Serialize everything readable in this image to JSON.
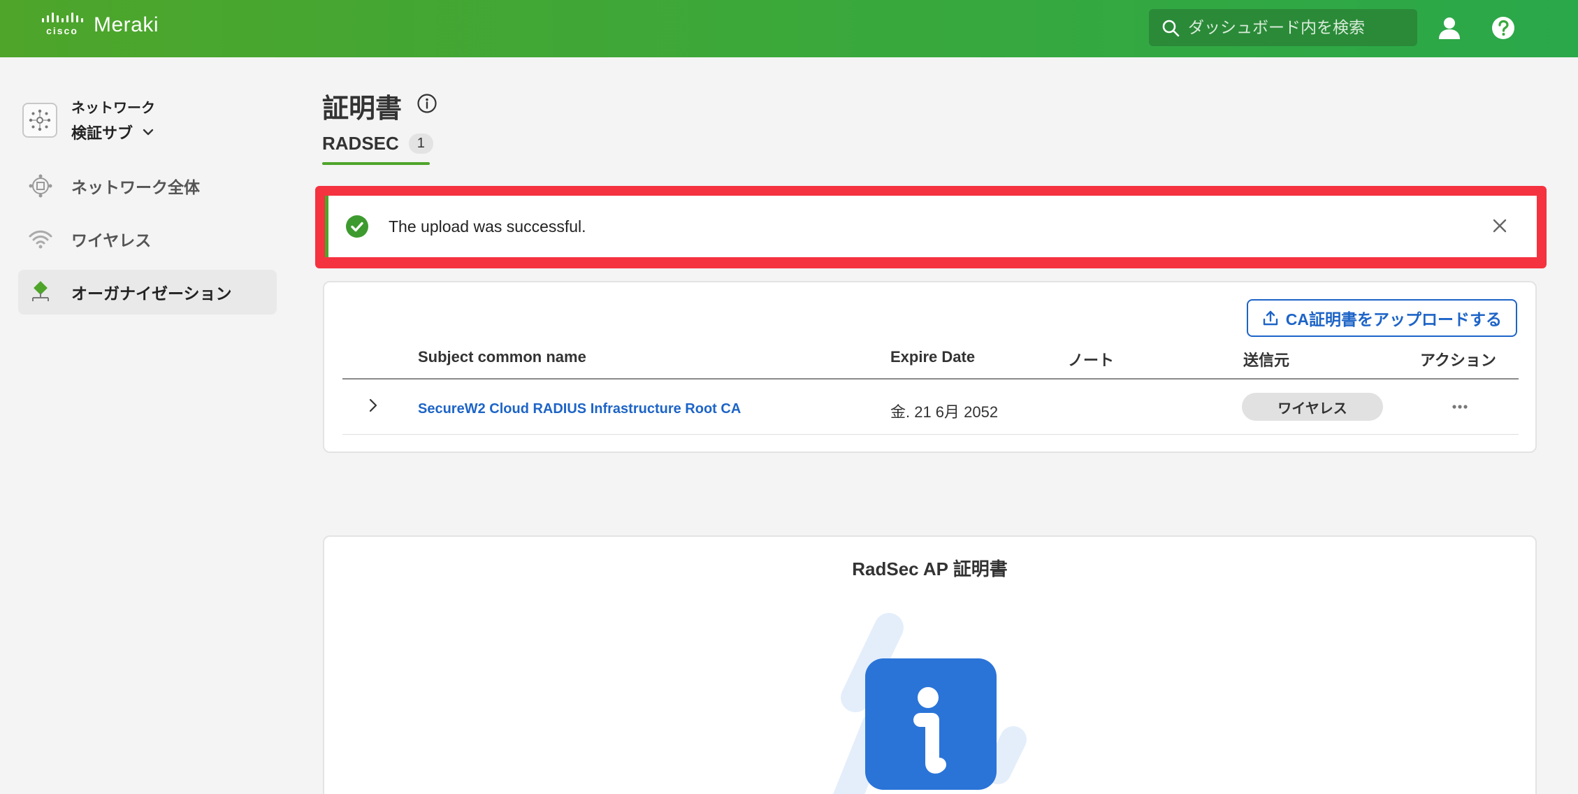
{
  "header": {
    "brand_sub": "cisco",
    "brand_name": "Meraki",
    "search_placeholder": "ダッシュボード内を検索"
  },
  "sidebar": {
    "network_label": "ネットワーク",
    "network_name": "検証サブ",
    "items": [
      {
        "label": "ネットワーク全体"
      },
      {
        "label": "ワイヤレス"
      },
      {
        "label": "オーガナイゼーション"
      }
    ]
  },
  "page": {
    "title": "証明書",
    "tab_label": "RADSEC",
    "tab_count": "1"
  },
  "alert": {
    "message": "The upload was successful."
  },
  "certificates": {
    "upload_label": "CA証明書をアップロードする",
    "columns": [
      "Subject common name",
      "Expire Date",
      "ノート",
      "送信元",
      "アクション"
    ],
    "rows": [
      {
        "name": "SecureW2 Cloud RADIUS Infrastructure Root CA",
        "expire": "金. 21 6月 2052",
        "note": "",
        "source": "ワイヤレス"
      }
    ]
  },
  "ap_section": {
    "title": "RadSec AP 証明書"
  },
  "colors": {
    "brand_green": "#4ea52a",
    "link_blue": "#1d64c7",
    "alert_highlight": "#f5323f"
  }
}
